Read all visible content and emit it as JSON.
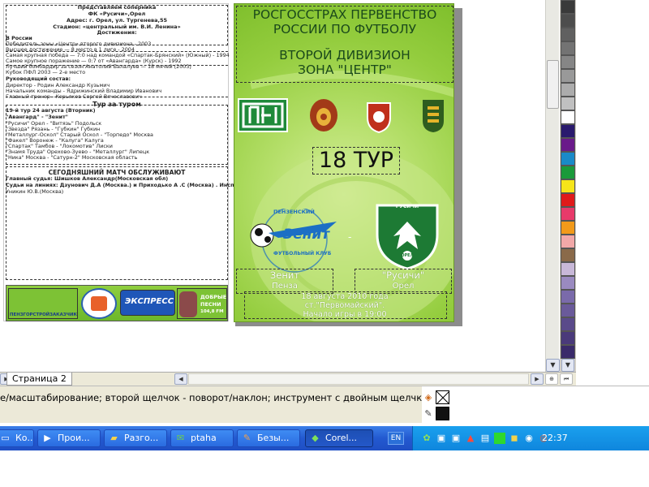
{
  "document": {
    "left_page": {
      "header_lines": [
        "Представляем соперника",
        "ФК «Русичи»,Орел",
        "Адрес: г. Орел, ул. Тургенева,55",
        "Стадион: «центральный им. В.И. Ленина»",
        "Достижения:"
      ],
      "achievements": [
        "В России",
        "Победитель зоны «Центр» второго дивизиона - 2003",
        "Высшее достижение — 8 место в 1 лиге - 2004",
        "Самая крупная победа — 7:0 над командой «Спартак-Брянский» (Южный) - 1994",
        "Самое крупное поражение — 0:7 от «Авангарда» (Курск) - 1992",
        "Лучший бомбардир за сезон Анатолий Балалуев — 18 мячей (2003)",
        "Кубок ПФЛ 2003 — 2-е место"
      ],
      "staff_heading": "Руководящий состав:",
      "staff": [
        "Директор - Родин Александр Кузьмич",
        "Начальник команды - Ядрижинский Владимир Иванович",
        "Главный тренер - Корьяков Сергей Вячеславович"
      ],
      "tour_heading": "Тур за туром",
      "tour_subheading": "19-й тур 24 августа (Вторник)",
      "matches": [
        "\"Авангард\" - \"Зенит\"",
        "\"Русичи\" Орел - \"Витязь\" Подольск",
        "\"Звезда\" Рязань - \"Губкин\" Губкин",
        "\"Металлург-Оскол\" Старый Оскол - \"Торпедо\" Москва",
        "\"Факел\" Воронеж - \"Калуга\" Калуга",
        "\"Спартак\" Тамбов - \"Локомотив\" Лиски",
        "\"Знамя Труда\" Орехово-Зуево - \"Металлург\" Липецк",
        "\"Ника\" Москва - \"Сатурн-2\" Московская область"
      ],
      "referee_heading": "СЕГОДНЯШНИЙ МАТЧ ОБСЛУЖИВАЮТ",
      "referees": [
        "Главный судья: Шишков Александр(Московская обл)",
        "Судьи на линиях: Дзунович Д.А (Москва.) и Приходько А .С (Москва) . Инспектор матча:",
        "Уникин Ю.В.(Москва)"
      ],
      "sponsors": {
        "sponsor1": "ПЕНЗГОРСТРОЙЗАКАЗЧИК",
        "sponsor2": "ЭКСПРЕСС",
        "sponsor3_line1": "ДОБРЫЕ",
        "sponsor3_line2": "ПЕСНИ",
        "sponsor3_line3": "104,8 FM"
      }
    },
    "right_page": {
      "title_line1": "РОСГОССТРАХ ПЕРВЕНСТВО",
      "title_line2": "РОССИИ ПО ФУТБОЛУ",
      "subtitle_line1": "ВТОРОЙ ДИВИЗИОН",
      "subtitle_line2": "ЗОНА \"ЦЕНТР\"",
      "tour": "18 ТУР",
      "home_team_name": "Зенит",
      "home_team_city": "Пенза",
      "away_team_name": "\"Русичи\"",
      "away_team_city": "Орел",
      "zenit_logo_line1": "ПЕНЗЕНСКИЙ",
      "zenit_logo_word": "Зенит",
      "zenit_logo_line2": "ФУТБОЛЬНЫЙ КЛУБ",
      "rusichi_logo_text": "РУСИЧИ",
      "rusichi_logo_small": "ОРЕЛ",
      "separator": "-",
      "match_date": "18 августа 2010 года",
      "match_venue": "ст.\"Первомайский\".",
      "match_time": "Начало игры в 19:00"
    }
  },
  "page_tabs": {
    "active_tab": "Страница 2"
  },
  "status_bar": {
    "hint_text": "е/масштабирование; второй щелчок - поворот/наклон; инструмент с двойным щелчком выбира..."
  },
  "taskbar": {
    "items": [
      {
        "label": "Ко...",
        "icon": "window-icon"
      },
      {
        "label": "Прои...",
        "icon": "media-player-icon"
      },
      {
        "label": "Разго...",
        "icon": "folder-icon"
      },
      {
        "label": "ptaha",
        "icon": "chat-icon"
      },
      {
        "label": "Безы...",
        "icon": "paint-icon"
      },
      {
        "label": "Corel...",
        "icon": "coreldraw-icon"
      }
    ],
    "language": "EN",
    "clock": "22:37"
  },
  "colors": {
    "green_cover": "#94cd3e",
    "taskbar_blue": "#2359d0",
    "tray_blue": "#0f86dd"
  }
}
